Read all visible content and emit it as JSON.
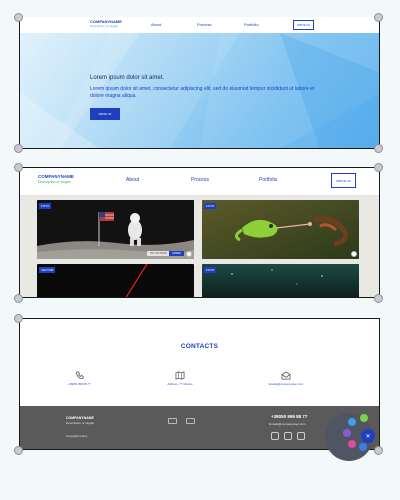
{
  "site": {
    "company_name": "COMPANYNAME",
    "company_description": "Description or slogan"
  },
  "frame1": {
    "nav": {
      "about": "About",
      "process": "Process",
      "portfolio": "Portfolio",
      "cta": "WRITE US"
    },
    "hero": {
      "title": "Lorem ipsum dolor sit amet.",
      "text": "Lorem ipsum dolor sit amet, consectetur adipiscing elit, sed do eiusmod tempor incididunt ut labore et dolore magna aliqua.",
      "button": "WRITE US"
    }
  },
  "frame2": {
    "nav": {
      "about": "About",
      "process": "Process",
      "portfolio": "Portfolio",
      "cta": "WRITE US"
    },
    "cards": [
      {
        "tag": "FOTO",
        "pill": "TRY ON HOLD",
        "button": "ORDER"
      },
      {
        "tag": "FOTO",
        "pill": "",
        "button": "ORDER"
      },
      {
        "tag": "VECTOR"
      },
      {
        "tag": "FOTO"
      }
    ]
  },
  "frame3": {
    "contacts_title": "CONTACTS",
    "contacts": [
      {
        "icon": "phone-icon",
        "label": "+38050 999 88 77"
      },
      {
        "icon": "map-icon",
        "label": "Address, 77 Ukraine"
      },
      {
        "icon": "mail-icon",
        "label": "Emaile@companyuser.com"
      }
    ],
    "footer": {
      "company_name": "COMPANYNAME",
      "description": "Description or slogan",
      "copyright": "Copyright policy",
      "phone": "+38050 999 88 77",
      "email": "Emaile@companyuser.com"
    }
  },
  "colors": {
    "brand_blue": "#1e3fc0",
    "footer_gray": "#5b5a5a",
    "slogan_green": "#2bb673"
  }
}
